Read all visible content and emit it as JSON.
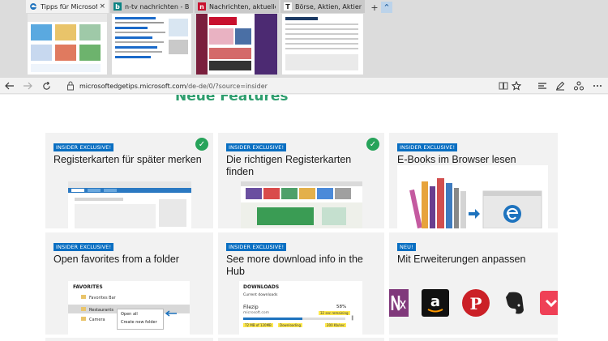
{
  "tabs": [
    {
      "title": "Tipps für Microsoft Edg",
      "favicon": "e",
      "favicon_color": "#1e73be",
      "active": true
    },
    {
      "title": "n-tv nachrichten - Bing",
      "favicon": "b",
      "favicon_color": "#0c8484",
      "active": false
    },
    {
      "title": "Nachrichten, aktuelle Schla",
      "favicon": "n",
      "favicon_color": "#c8102e",
      "active": false
    },
    {
      "title": "Börse, Aktien, Aktienkurse, I",
      "favicon": "T",
      "favicon_color": "#222222",
      "active": false
    }
  ],
  "tab_close_glyph": "×",
  "tabbar_buttons": {
    "new_tab": "+",
    "collapse": "⌃"
  },
  "nav": {
    "url_domain": "microsoftedgetips.microsoft.com",
    "url_path": "/de-de/0/?source=insider"
  },
  "page": {
    "section_title": "Neue Features",
    "cards": [
      {
        "badge": "INSIDER EXCLUSIVE!",
        "title": "Registerkarten für später merken",
        "checked": true
      },
      {
        "badge": "INSIDER EXCLUSIVE!",
        "title": "Die richtigen Registerkarten finden",
        "checked": true
      },
      {
        "badge": "INSIDER EXCLUSIVE!",
        "title": "E-Books im Browser lesen",
        "checked": false
      },
      {
        "badge": "INSIDER EXCLUSIVE!",
        "title": "Open favorites from a folder",
        "checked": false
      },
      {
        "badge": "INSIDER EXCLUSIVE!",
        "title": "See more download info in the Hub",
        "checked": false
      },
      {
        "badge": "NEU!",
        "title": "Mit Erweiterungen anpassen",
        "checked": false
      }
    ],
    "favorites_mock": {
      "header": "FAVORITES",
      "items": [
        "Favorites Bar",
        "Restaurants",
        "Camera"
      ],
      "menu": [
        "Open all",
        "Create new folder"
      ]
    },
    "downloads_mock": {
      "header": "DOWNLOADS",
      "sub": "Current downloads",
      "file": "Filezip",
      "source": "microsoft.com",
      "percent": "58%",
      "progress": 0.58,
      "remaining": "32 sec remaining",
      "size": "72 MB of 120MB",
      "status": "Downloading",
      "speed": "200 Kb/sec"
    }
  },
  "colors": {
    "accent_green": "#2e9e6e",
    "badge_blue": "#0a6fc2",
    "check_green": "#27a35a"
  }
}
